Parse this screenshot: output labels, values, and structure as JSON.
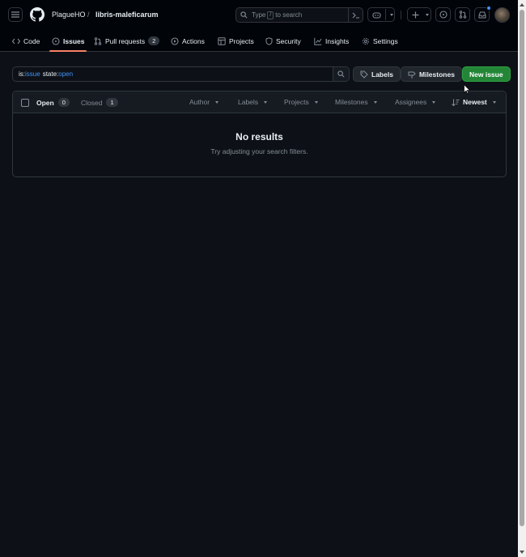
{
  "header": {
    "owner": "PlagueHO",
    "separator": "/",
    "repo": "libris-maleficarum",
    "search_prefix": "Type",
    "search_key": "/",
    "search_suffix": "to search"
  },
  "nav": {
    "code": "Code",
    "issues": "Issues",
    "pull_requests": "Pull requests",
    "pull_requests_count": "2",
    "actions": "Actions",
    "projects": "Projects",
    "security": "Security",
    "insights": "Insights",
    "settings": "Settings"
  },
  "filter": {
    "q1_key": "is:",
    "q1_val": "issue",
    "q2_key": "state:",
    "q2_val": "open"
  },
  "buttons": {
    "labels": "Labels",
    "milestones": "Milestones",
    "new_issue": "New issue"
  },
  "list": {
    "open_label": "Open",
    "open_count": "0",
    "closed_label": "Closed",
    "closed_count": "1",
    "author": "Author",
    "labels": "Labels",
    "projects": "Projects",
    "milestones": "Milestones",
    "assignees": "Assignees",
    "sort": "Newest",
    "empty_title": "No results",
    "empty_sub": "Try adjusting your search filters."
  },
  "colors": {
    "background": "#0d1117",
    "accent_blue": "#4493f8",
    "primary_green": "#238636",
    "active_underline": "#f78166"
  }
}
